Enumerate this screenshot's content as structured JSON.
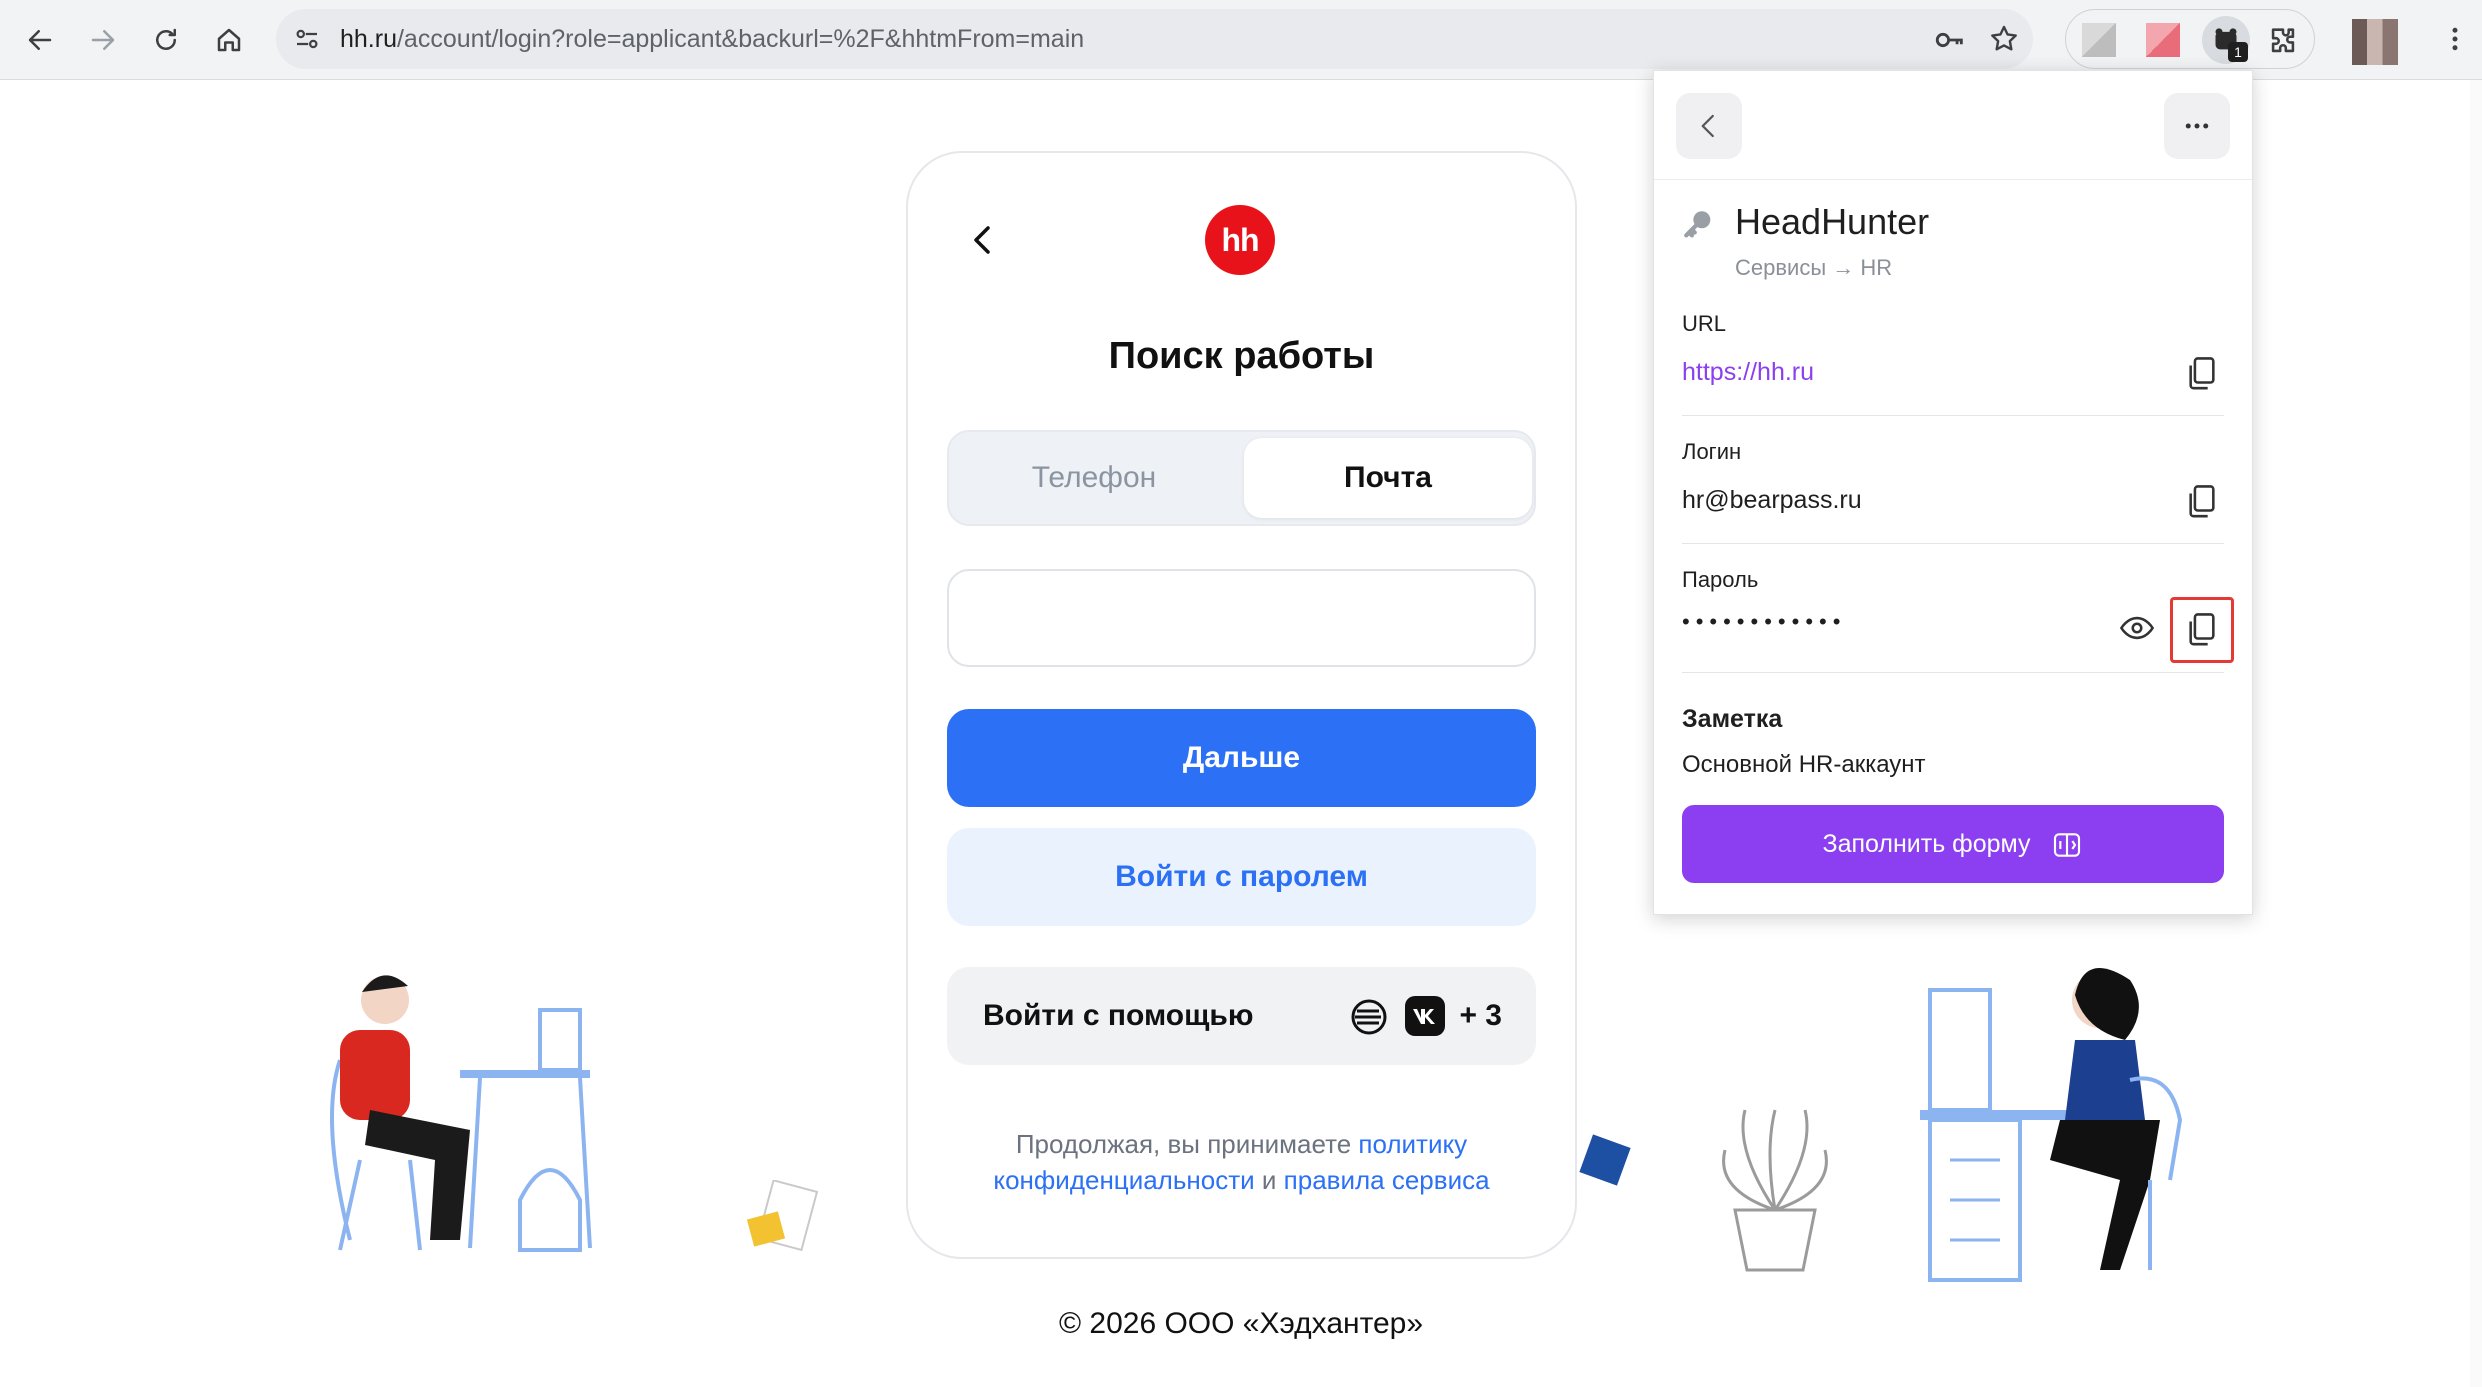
{
  "browser": {
    "url_host": "hh.ru",
    "url_path": "/account/login?role=applicant&backurl=%2F&hhtmFrom=main",
    "extension_badge": "1"
  },
  "login": {
    "logo_text": "hh",
    "title": "Поиск работы",
    "tab_phone": "Телефон",
    "tab_email": "Почта",
    "email_value": "",
    "next_button": "Дальше",
    "password_button": "Войти с паролем",
    "social_label": "Войти с помощью",
    "social_more": "+ 3",
    "legal_prefix": "Продолжая, вы принимаете",
    "legal_link1": "политику конфиденциальности",
    "legal_mid": "и",
    "legal_link2": "правила сервиса"
  },
  "footer": {
    "copyright": "© 2026 ООО «Хэдхантер»"
  },
  "password_manager": {
    "item_name": "HeadHunter",
    "item_path": "Сервисы → HR",
    "url_label": "URL",
    "url_value": "https://hh.ru",
    "login_label": "Логин",
    "login_value": "hr@bearpass.ru",
    "password_label": "Пароль",
    "password_masked": "••••••••••••",
    "note_label": "Заметка",
    "note_value": "Основной HR-аккаунт",
    "fill_button": "Заполнить форму"
  },
  "colors": {
    "brand_red": "#e8131a",
    "primary_blue": "#2b70f5",
    "accent_purple": "#8b3ff0",
    "link_purple": "#8b3ff0",
    "highlight_red": "#e53935"
  }
}
